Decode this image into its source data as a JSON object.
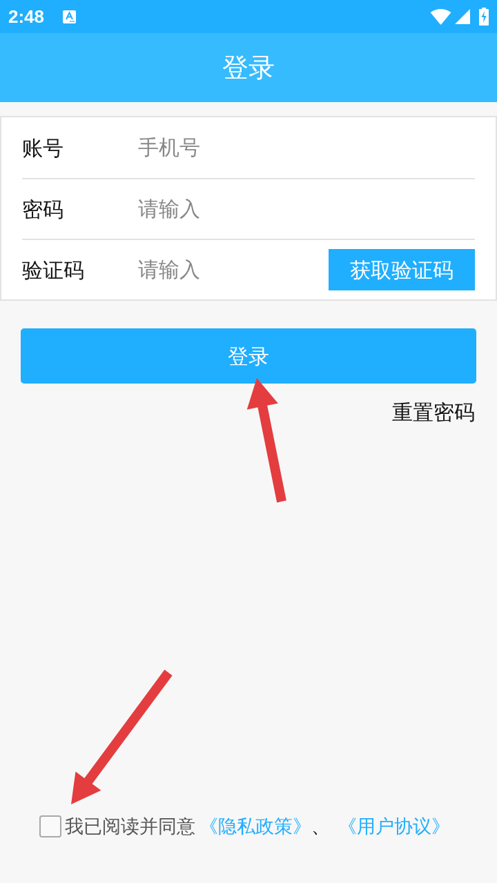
{
  "status_bar": {
    "time": "2:48"
  },
  "header": {
    "title": "登录"
  },
  "form": {
    "rows": [
      {
        "kind": "input",
        "label": "账号",
        "placeholder": "手机号"
      },
      {
        "kind": "input",
        "label": "密码",
        "placeholder": "请输入"
      },
      {
        "kind": "code",
        "label": "验证码",
        "placeholder": "请输入",
        "button": "获取验证码"
      }
    ]
  },
  "login_button": "登录",
  "reset_password": "重置密码",
  "agreement": {
    "checked": false,
    "text": "我已阅读并同意",
    "links": [
      "《隐私政策》",
      "《用户协议》"
    ],
    "separator": "、"
  },
  "annotations": [
    {
      "kind": "arrow"
    },
    {
      "kind": "arrow"
    }
  ]
}
